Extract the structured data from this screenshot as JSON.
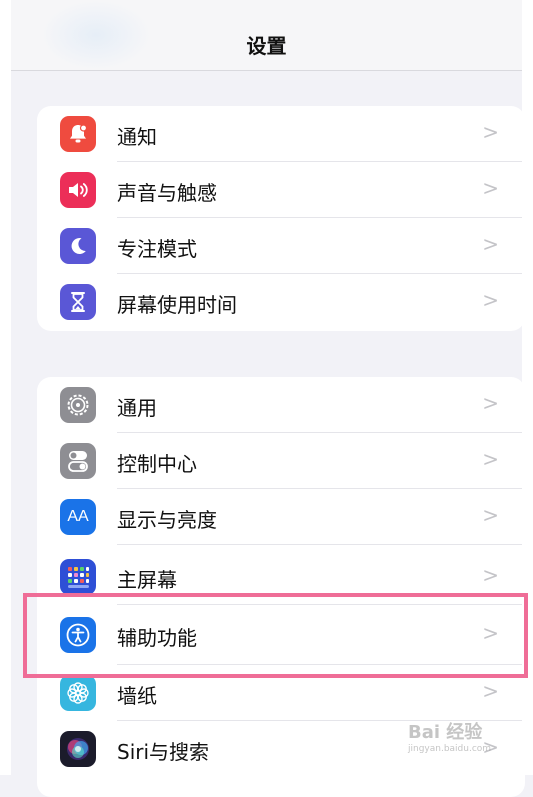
{
  "header": {
    "title": "设置"
  },
  "groups": [
    {
      "items": [
        {
          "label": "通知",
          "icon": "bell-icon",
          "color": "#ef4b3f"
        },
        {
          "label": "声音与触感",
          "icon": "speaker-icon",
          "color": "#ec2e58"
        },
        {
          "label": "专注模式",
          "icon": "moon-icon",
          "color": "#5a57d6"
        },
        {
          "label": "屏幕使用时间",
          "icon": "hourglass-icon",
          "color": "#5a57d6"
        }
      ]
    },
    {
      "items": [
        {
          "label": "通用",
          "icon": "gear-icon",
          "color": "#8e8e93"
        },
        {
          "label": "控制中心",
          "icon": "toggles-icon",
          "color": "#8e8e93"
        },
        {
          "label": "显示与亮度",
          "icon": "text-size-icon",
          "color": "#1a73e8",
          "text": "AA"
        },
        {
          "label": "主屏幕",
          "icon": "app-grid-icon",
          "color": "#2e4fd6"
        },
        {
          "label": "辅助功能",
          "icon": "accessibility-icon",
          "color": "#1a73e8"
        },
        {
          "label": "墙纸",
          "icon": "flower-icon",
          "color": "#36b6df"
        },
        {
          "label": "Siri与搜索",
          "icon": "siri-icon",
          "color": "#1b1b2b"
        }
      ]
    }
  ],
  "chevron": ">",
  "watermark": {
    "text": "Bai 经验",
    "sub": "jingyan.baidu.com"
  }
}
